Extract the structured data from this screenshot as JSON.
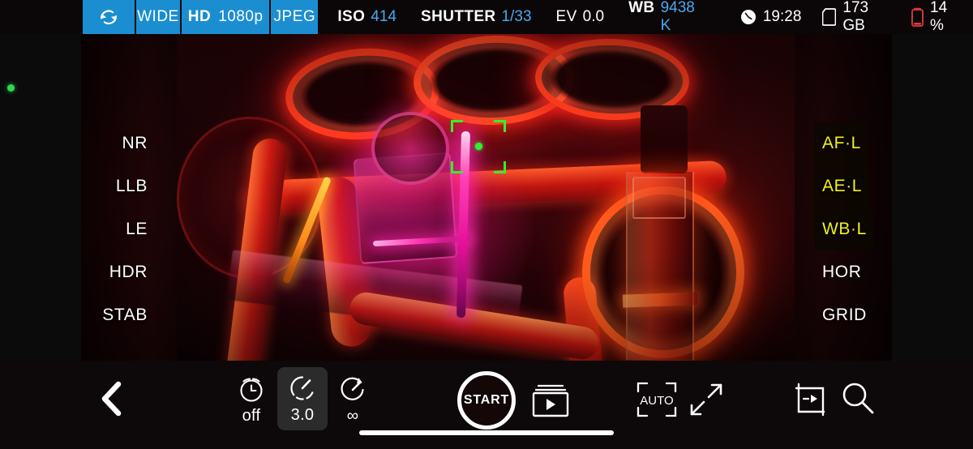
{
  "app": {
    "name": "pro-camera-viewfinder"
  },
  "topbar": {
    "flip_icon": "camera-flip-icon",
    "lens": "WIDE",
    "quality_prefix": "HD",
    "quality_value": "1080p",
    "format": "JPEG",
    "exposure": [
      {
        "key": "ISO",
        "value": "414",
        "key_bold": true,
        "value_blue": true
      },
      {
        "key": "SHUTTER",
        "value": "1/33",
        "key_bold": true,
        "value_blue": true
      },
      {
        "key": "EV",
        "value": "0.0",
        "key_bold": false,
        "value_blue": false
      },
      {
        "key": "WB",
        "value": "9438 K",
        "key_bold": true,
        "value_blue": true
      }
    ],
    "status": [
      {
        "icon": "clock-icon",
        "text": "19:28"
      },
      {
        "icon": "sdcard-icon",
        "text": "173 GB"
      },
      {
        "icon": "battery-low-icon",
        "text": "14 %"
      }
    ],
    "colors": {
      "segment_blue": "#1b8ed2",
      "value_blue": "#4aa8ef",
      "bar_bg": "#0b0708"
    }
  },
  "viewfinder": {
    "left_labels": [
      {
        "label": "NR",
        "locked": false
      },
      {
        "label": "LLB",
        "locked": false
      },
      {
        "label": "LE",
        "locked": false
      },
      {
        "label": "HDR",
        "locked": false
      },
      {
        "label": "STAB",
        "locked": false
      }
    ],
    "right_labels": [
      {
        "label": "AF·L",
        "locked": true
      },
      {
        "label": "AE·L",
        "locked": true
      },
      {
        "label": "WB·L",
        "locked": true
      },
      {
        "label": "HOR",
        "locked": false
      },
      {
        "label": "GRID",
        "locked": false
      }
    ],
    "focus_reticle": {
      "name": "focus-reticle",
      "color": "#2ef22e"
    },
    "edge_indicator": {
      "name": "recording-status-dot",
      "color": "#2fd64f"
    },
    "scene": "red-lit pc water cooling loop with three glowing fan rings, coolant tubing, magenta cpu block glow and a lit reservoir tube"
  },
  "toolbar": {
    "back": {
      "name": "back-button",
      "icon": "chevron-left-icon"
    },
    "self_timer": {
      "name": "self-timer-button",
      "icon": "alarm-clock-icon",
      "caption": "off",
      "selected": false
    },
    "interval": {
      "name": "interval-timer-button",
      "icon": "dial-timer-icon",
      "caption": "3.0",
      "selected": true
    },
    "duration": {
      "name": "duration-button",
      "icon": "stopwatch-icon",
      "caption": "∞",
      "selected": false
    },
    "shutter": {
      "name": "start-record-button",
      "label": "START"
    },
    "gallery": {
      "name": "gallery-playback-button",
      "icon": "media-stack-play-icon"
    },
    "auto": {
      "name": "auto-mode-button",
      "icon": "auto-bracket-icon",
      "label": "AUTO"
    },
    "resize": {
      "name": "resize-button",
      "icon": "diagonal-arrows-icon"
    },
    "crop": {
      "name": "crop-preview-button",
      "icon": "crop-frame-play-icon"
    },
    "search": {
      "name": "zoom-search-button",
      "icon": "magnifier-icon"
    },
    "colors": {
      "selected_bg": "#2b2b2b",
      "bar_bg": "#0d0809"
    }
  },
  "system": {
    "home_indicator": "home-indicator-bar"
  }
}
